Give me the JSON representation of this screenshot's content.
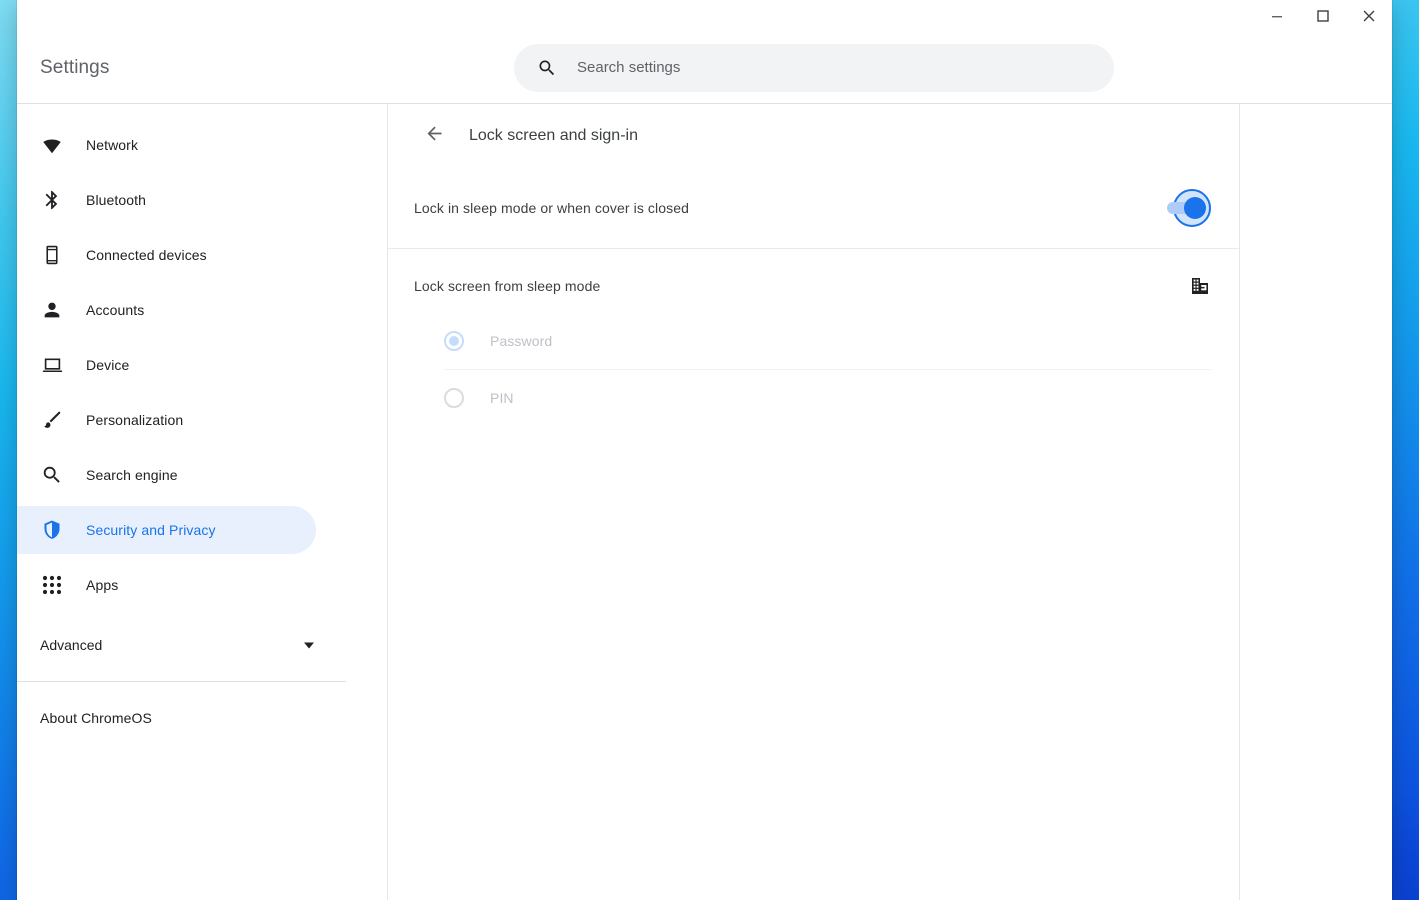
{
  "window": {
    "controls": [
      {
        "name": "minimize",
        "label": "—"
      },
      {
        "name": "maximize",
        "label": "□"
      },
      {
        "name": "close",
        "label": "✕"
      }
    ]
  },
  "header": {
    "app_title": "Settings",
    "search": {
      "placeholder": "Search settings",
      "value": "",
      "icon": "search-icon"
    }
  },
  "sidebar": {
    "items": [
      {
        "id": "network",
        "label": "Network",
        "icon": "wifi-icon",
        "selected": false
      },
      {
        "id": "bluetooth",
        "label": "Bluetooth",
        "icon": "bluetooth-icon",
        "selected": false
      },
      {
        "id": "connected",
        "label": "Connected devices",
        "icon": "phone-icon",
        "selected": false
      },
      {
        "id": "accounts",
        "label": "Accounts",
        "icon": "person-icon",
        "selected": false
      },
      {
        "id": "device",
        "label": "Device",
        "icon": "laptop-icon",
        "selected": false
      },
      {
        "id": "personal",
        "label": "Personalization",
        "icon": "brush-icon",
        "selected": false
      },
      {
        "id": "searcheng",
        "label": "Search engine",
        "icon": "magnifier-icon",
        "selected": false
      },
      {
        "id": "security",
        "label": "Security and Privacy",
        "icon": "shield-icon",
        "selected": true
      },
      {
        "id": "apps",
        "label": "Apps",
        "icon": "apps-grid-icon",
        "selected": false
      }
    ],
    "advanced": {
      "label": "Advanced",
      "icon": "chevron-down-icon"
    },
    "about": {
      "label": "About ChromeOS"
    }
  },
  "main": {
    "back_icon": "arrow-back-icon",
    "page_title": "Lock screen and sign-in",
    "sleep_lock": {
      "label": "Lock in sleep mode or when cover is closed",
      "toggle_state": "on",
      "focused": true
    },
    "lock_section": {
      "title": "Lock screen from sleep mode",
      "managed_icon": "enterprise-building-icon",
      "options": [
        {
          "id": "password",
          "label": "Password",
          "checked": true,
          "disabled": true
        },
        {
          "id": "pin",
          "label": "PIN",
          "checked": false,
          "disabled": true
        }
      ]
    }
  },
  "colors": {
    "accent": "#1a73e8",
    "selected_bg": "#e8f0fe",
    "text_primary": "#202124",
    "text_secondary": "#5f6368",
    "disabled_text": "#bdc1c6",
    "search_bg": "#f1f3f4"
  }
}
